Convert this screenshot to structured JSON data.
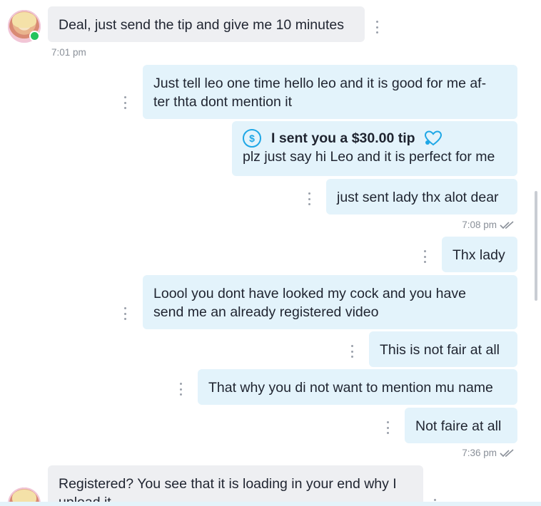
{
  "messages": {
    "m1": {
      "text": "Deal, just send the tip and give me 10 minutes",
      "time": "7:01 pm"
    },
    "m2": {
      "line1": "Just tell leo one time hello leo and it is good for me af-",
      "line2": "ter thta dont mention it"
    },
    "m3": {
      "tip_label": "I sent you a $30.00 tip",
      "text": "plz just say hi Leo and it is perfect for me"
    },
    "m4": {
      "text": "just sent lady thx alot dear",
      "time": "7:08 pm"
    },
    "m5": {
      "text": "Thx lady"
    },
    "m6": {
      "line1": "Loool you dont have looked my cock and you have",
      "line2": "send me an already registered video"
    },
    "m7": {
      "text": "This is not fair at all"
    },
    "m8": {
      "text": "That why you di not want to mention mu name"
    },
    "m9": {
      "text": "Not faire at all",
      "time": "7:36 pm"
    },
    "m10": {
      "line1": "Registered? You see that it is loading in your end why I",
      "line2": "upload it"
    }
  },
  "icons": {
    "tip": "dollar-circle-icon",
    "heart": "heart-icon",
    "read": "double-check-icon",
    "menu": "vertical-dots-icon"
  },
  "colors": {
    "incoming_bubble": "#eeeff2",
    "outgoing_bubble": "#e3f3fb",
    "accent": "#1ea7e6",
    "online": "#25c35c"
  }
}
